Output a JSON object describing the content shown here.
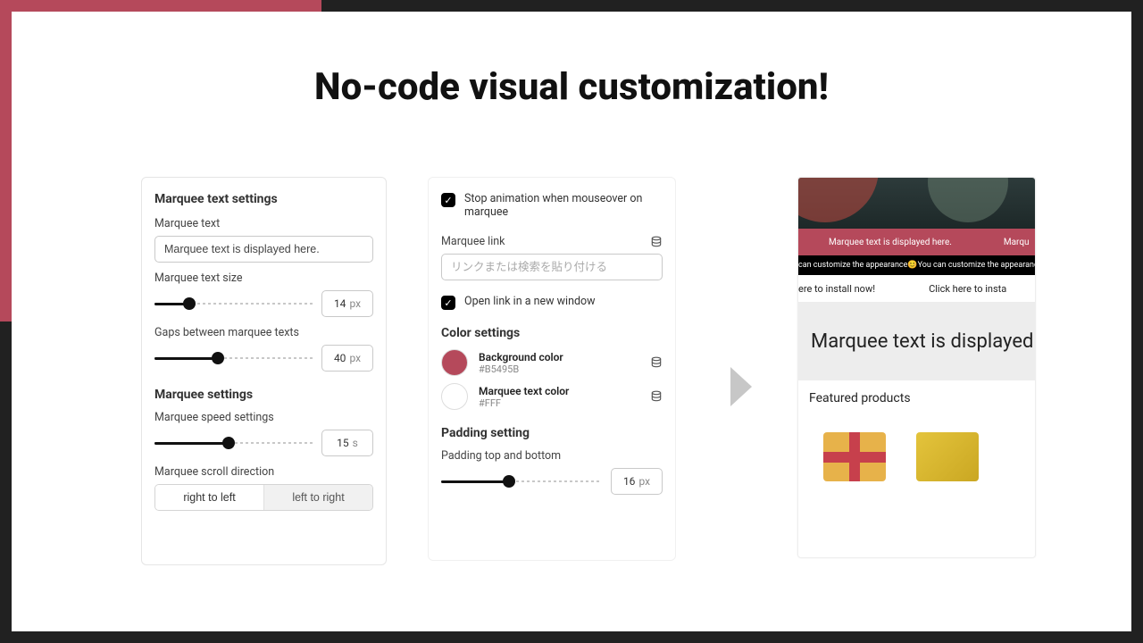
{
  "headline": "No-code visual customization!",
  "panel1": {
    "title": "Marquee text settings",
    "text_label": "Marquee text",
    "text_value": "Marquee text is displayed here.",
    "size_label": "Marquee text size",
    "size_value": "14",
    "size_unit": "px",
    "size_fill_pct": 22,
    "gap_label": "Gaps between marquee texts",
    "gap_value": "40",
    "gap_unit": "px",
    "gap_fill_pct": 40,
    "settings_title": "Marquee settings",
    "speed_label": "Marquee speed settings",
    "speed_value": "15",
    "speed_unit": "s",
    "speed_fill_pct": 47,
    "dir_label": "Marquee scroll direction",
    "dir_rtl": "right to left",
    "dir_ltr": "left to right"
  },
  "panel2": {
    "stop_label": "Stop animation when mouseover on marquee",
    "link_label": "Marquee link",
    "link_placeholder": "リンクまたは検索を貼り付ける",
    "open_new_label": "Open link in a new window",
    "color_title": "Color settings",
    "bg_name": "Background color",
    "bg_hex": "#B5495B",
    "fg_name": "Marquee text color",
    "fg_hex": "#FFF",
    "pad_title": "Padding setting",
    "pad_label": "Padding top and bottom",
    "pad_value": "16",
    "pad_unit": "px",
    "pad_fill_pct": 42
  },
  "preview": {
    "marquee1_a": "Marquee text is displayed here.",
    "marquee1_b": "Marqu",
    "marquee2": "can customize the appearance😊You can customize the appearanc",
    "marquee3_a": "ere to install now!",
    "marquee3_b": "Click here to insta",
    "big": "Marquee text is displayed h",
    "featured": "Featured products"
  }
}
